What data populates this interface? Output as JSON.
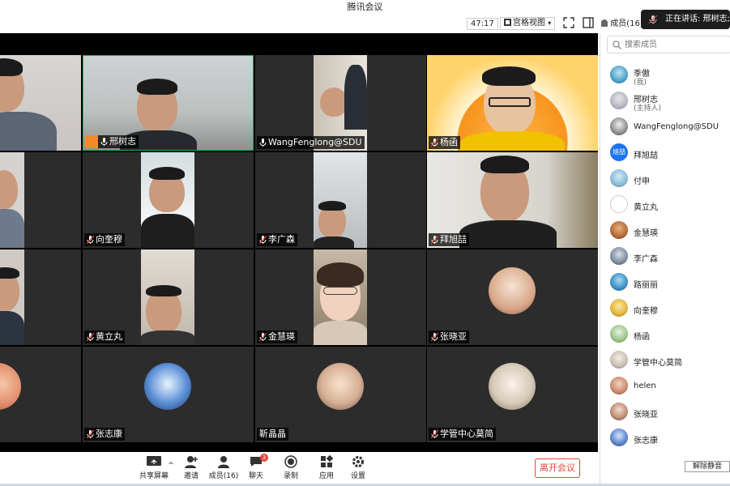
{
  "app_title": "腾讯会议",
  "topbar": {
    "timer": "47:17",
    "view_mode": "宫格视图",
    "members_label": "成员(16)"
  },
  "toast": {
    "speaking": "正在讲话: 邢树志;"
  },
  "tiles": [
    {
      "name": ""
    },
    {
      "name": "邢树志"
    },
    {
      "name": "WangFenglong@SDU"
    },
    {
      "name": "杨函"
    },
    {
      "name": ""
    },
    {
      "name": "向奎穆"
    },
    {
      "name": "李广森"
    },
    {
      "name": "拜旭喆"
    },
    {
      "name": ""
    },
    {
      "name": "黄立丸"
    },
    {
      "name": "金慧瑛"
    },
    {
      "name": "张晓亚"
    },
    {
      "name": ""
    },
    {
      "name": "张志康"
    },
    {
      "name": "靳晶晶"
    },
    {
      "name": "学管中心莫简"
    }
  ],
  "toolbar": {
    "share": "共享屏幕",
    "invite": "邀请",
    "members": "成员(16)",
    "chat": "聊天",
    "chat_badge": "3",
    "record": "录制",
    "apps": "应用",
    "settings": "设置",
    "leave": "离开会议"
  },
  "sidebar": {
    "search_placeholder": "搜索成员",
    "members": [
      {
        "name": "季傲",
        "sub": "(我)"
      },
      {
        "name": "邢树志",
        "sub": "(主持人)"
      },
      {
        "name": "WangFenglong@SDU",
        "sub": ""
      },
      {
        "name": "拜旭喆",
        "sub": "",
        "avatar_text": "旭喆"
      },
      {
        "name": "付申",
        "sub": ""
      },
      {
        "name": "黄立丸",
        "sub": ""
      },
      {
        "name": "金慧瑛",
        "sub": ""
      },
      {
        "name": "李广森",
        "sub": ""
      },
      {
        "name": "路丽丽",
        "sub": ""
      },
      {
        "name": "向奎穆",
        "sub": ""
      },
      {
        "name": "杨函",
        "sub": ""
      },
      {
        "name": "学管中心莫简",
        "sub": ""
      },
      {
        "name": "helen",
        "sub": ""
      },
      {
        "name": "张晓亚",
        "sub": ""
      },
      {
        "name": "张志康",
        "sub": ""
      }
    ],
    "unmute_all": "解除静音"
  },
  "colors": {
    "accent_orange": "#f08a2a",
    "leave_red": "#e6453a",
    "active_border": "#1aad5e"
  }
}
